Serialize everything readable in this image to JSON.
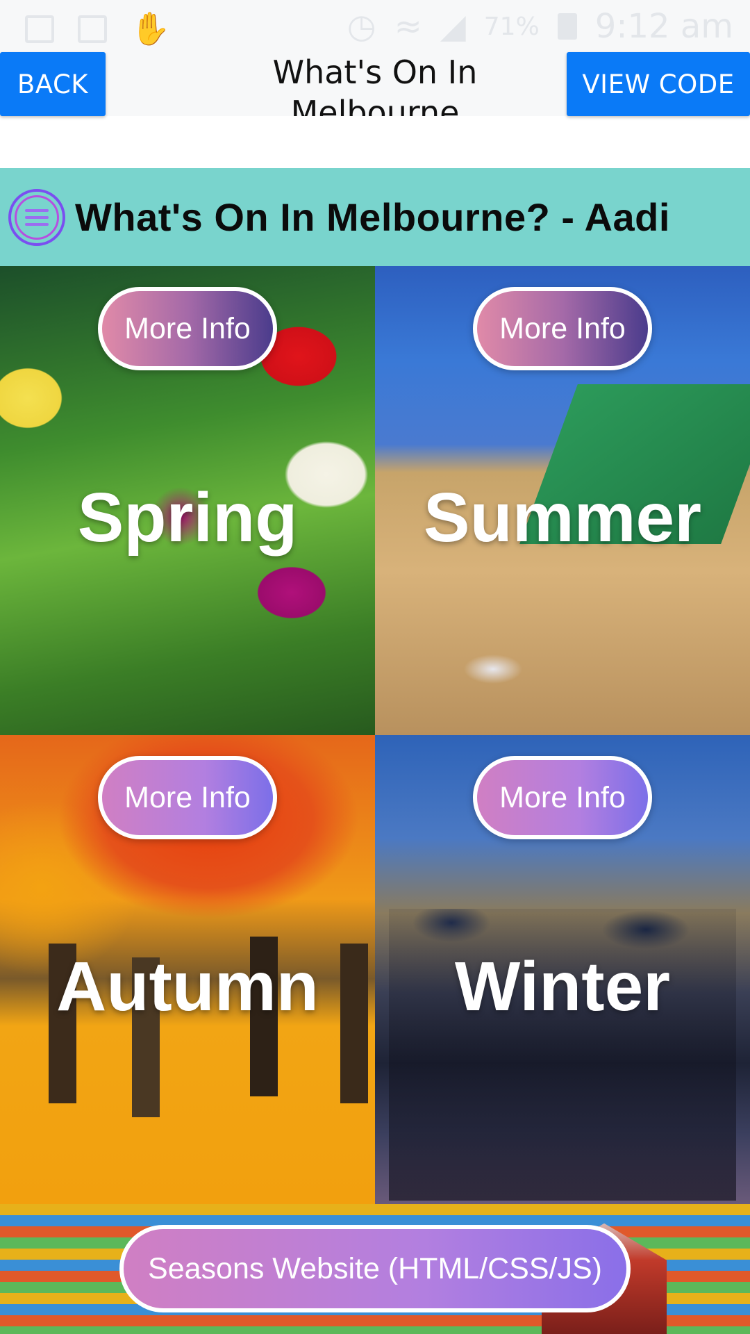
{
  "status_bar": {
    "battery_percent": "71%",
    "time": "9:12 am",
    "icons": [
      "mail-icon",
      "image-icon",
      "hand-icon",
      "alarm-icon",
      "wifi-icon",
      "signal-icon",
      "battery-icon"
    ]
  },
  "topbar": {
    "back_label": "BACK",
    "title": "What's On In Melbourne",
    "view_code_label": "VIEW CODE"
  },
  "app": {
    "title": "What's On In Melbourne? - Aadi"
  },
  "seasons": [
    {
      "name": "Spring",
      "button": "More Info"
    },
    {
      "name": "Summer",
      "button": "More Info"
    },
    {
      "name": "Autumn",
      "button": "More Info"
    },
    {
      "name": "Winter",
      "button": "More Info"
    }
  ],
  "footer": {
    "button": "Seasons Website (HTML/CSS/JS)"
  },
  "colors": {
    "primary_button": "#0a7af7",
    "app_header": "#79d4cd",
    "pill_gradient_start": "#d07fc3",
    "pill_gradient_end": "#7c6fe8"
  }
}
